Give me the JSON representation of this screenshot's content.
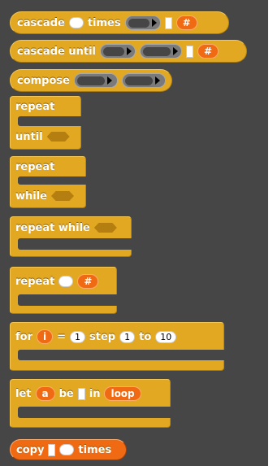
{
  "blocks": {
    "cascade_times": {
      "word1": "cascade",
      "word2": "times",
      "var_label": "#"
    },
    "cascade_until": {
      "word1": "cascade until",
      "var_label": "#"
    },
    "compose": {
      "word1": "compose"
    },
    "repeat_until": {
      "word1": "repeat",
      "word2": "until"
    },
    "repeat_while": {
      "word1": "repeat",
      "word2": "while"
    },
    "repeat_while_top": {
      "word1": "repeat while"
    },
    "repeat_count": {
      "word1": "repeat",
      "var_label": "#"
    },
    "for": {
      "word1": "for",
      "var": "i",
      "eq": "=",
      "start": "1",
      "step_label": "step",
      "step": "1",
      "to_label": "to",
      "end": "10"
    },
    "let": {
      "word1": "let",
      "var": "a",
      "be_label": "be",
      "in_label": "in",
      "loop_label": "loop"
    },
    "copy": {
      "word1": "copy",
      "word2": "times"
    }
  }
}
